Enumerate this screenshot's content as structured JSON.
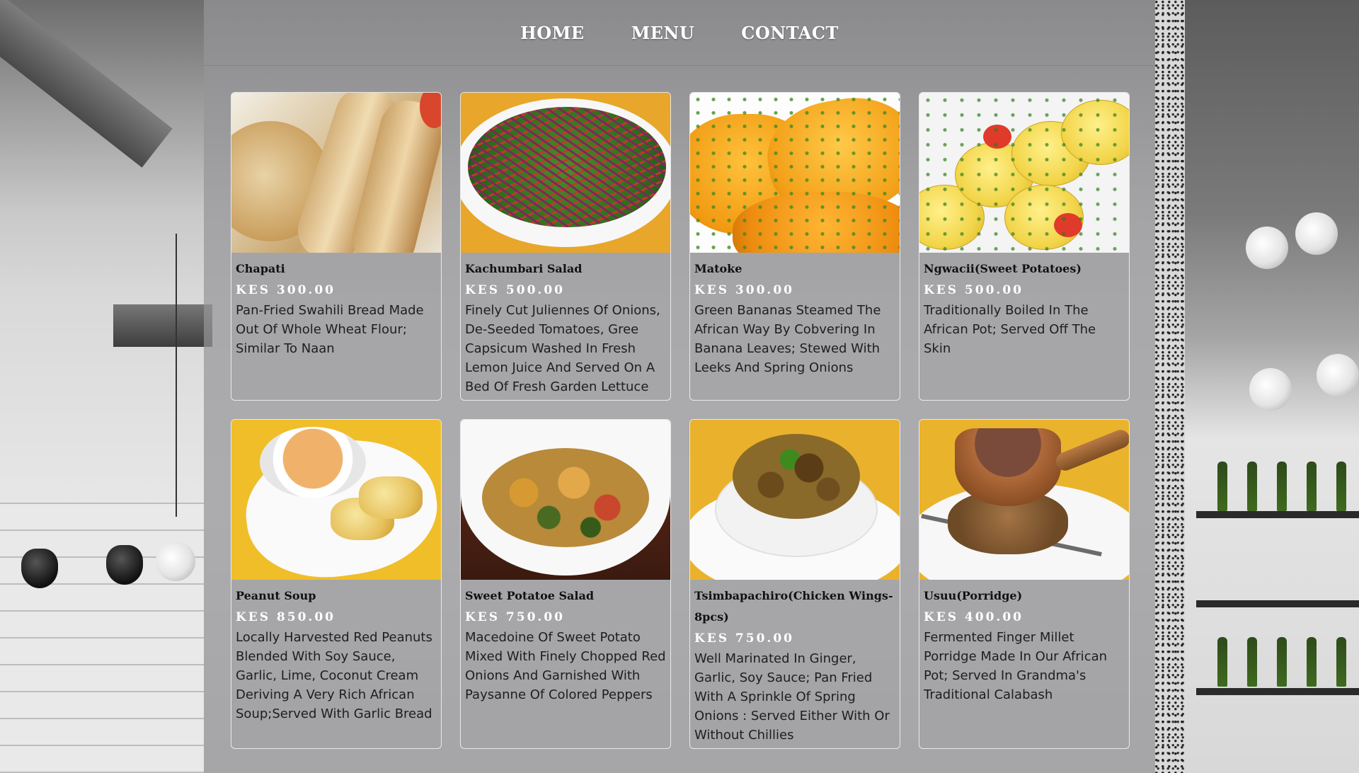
{
  "nav": {
    "items": [
      {
        "label": "HOME"
      },
      {
        "label": "MENU"
      },
      {
        "label": "CONTACT"
      }
    ]
  },
  "menu": {
    "items": [
      {
        "name": "Chapati",
        "price": "KES 300.00",
        "description": "Pan-Fried Swahili Bread Made Out Of Whole Wheat Flour; Similar To Naan",
        "image": "chapati-photo"
      },
      {
        "name": "Kachumbari Salad",
        "price": "KES 500.00",
        "description": "Finely Cut Juliennes Of Onions, De-Seeded Tomatoes, Gree Capsicum Washed In Fresh Lemon Juice And Served On A Bed Of Fresh Garden Lettuce",
        "image": "kachumbari-salad-photo"
      },
      {
        "name": "Matoke",
        "price": "KES 300.00",
        "description": "Green Bananas Steamed The African Way By Cobvering In Banana Leaves; Stewed With Leeks And Spring Onions",
        "image": "matoke-photo"
      },
      {
        "name": "Ngwacii(Sweet Potatoes)",
        "price": "KES 500.00",
        "description": "Traditionally Boiled In The African Pot; Served Off The Skin",
        "image": "ngwacii-photo"
      },
      {
        "name": "Peanut Soup",
        "price": "KES 850.00",
        "description": "Locally Harvested Red Peanuts Blended With Soy Sauce, Garlic, Lime, Coconut Cream Deriving A Very Rich African Soup;Served With Garlic Bread",
        "image": "peanut-soup-photo"
      },
      {
        "name": "Sweet Potatoe Salad",
        "price": "KES 750.00",
        "description": "Macedoine Of Sweet Potato Mixed With Finely Chopped Red Onions And Garnished With Paysanne Of Colored Peppers",
        "image": "sweet-potatoe-salad-photo"
      },
      {
        "name": "Tsimbapachiro(Chicken Wings-8pcs)",
        "price": "KES 750.00",
        "description": "Well Marinated In Ginger, Garlic, Soy Sauce; Pan Fried With A Sprinkle Of Spring Onions : Served Either With Or Without Chillies",
        "image": "tsimbapachiro-photo"
      },
      {
        "name": "Usuu(Porridge)",
        "price": "KES 400.00",
        "description": "Fermented Finger Millet Porridge Made In Our African Pot; Served In Grandma's Traditional Calabash",
        "image": "usuu-photo"
      }
    ]
  }
}
